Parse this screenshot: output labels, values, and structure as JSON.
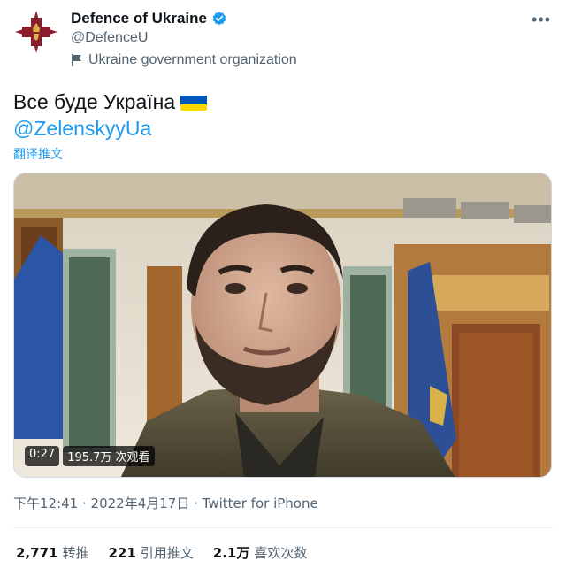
{
  "author": {
    "display_name": "Defence of Ukraine",
    "handle": "@DefenceU",
    "label": "Ukraine government organization"
  },
  "tweet": {
    "text": "Все буде Україна",
    "mention": "@ZelenskyyUa",
    "translate_link": "翻译推文",
    "flag_icon": "ukraine-flag-icon"
  },
  "media": {
    "duration": "0:27",
    "views": "195.7万 次观看"
  },
  "meta": {
    "line": "下午12:41 · 2022年4月17日 · Twitter for iPhone"
  },
  "stats": [
    {
      "count": "2,771",
      "label": "转推"
    },
    {
      "count": "221",
      "label": "引用推文"
    },
    {
      "count": "2.1万",
      "label": "喜欢次数"
    }
  ],
  "colors": {
    "accent": "#1d9bf0",
    "secondary_text": "#536471",
    "avatar_bg": "#8c1d2c",
    "flag_blue": "#0057b7",
    "flag_yellow": "#ffd700"
  }
}
